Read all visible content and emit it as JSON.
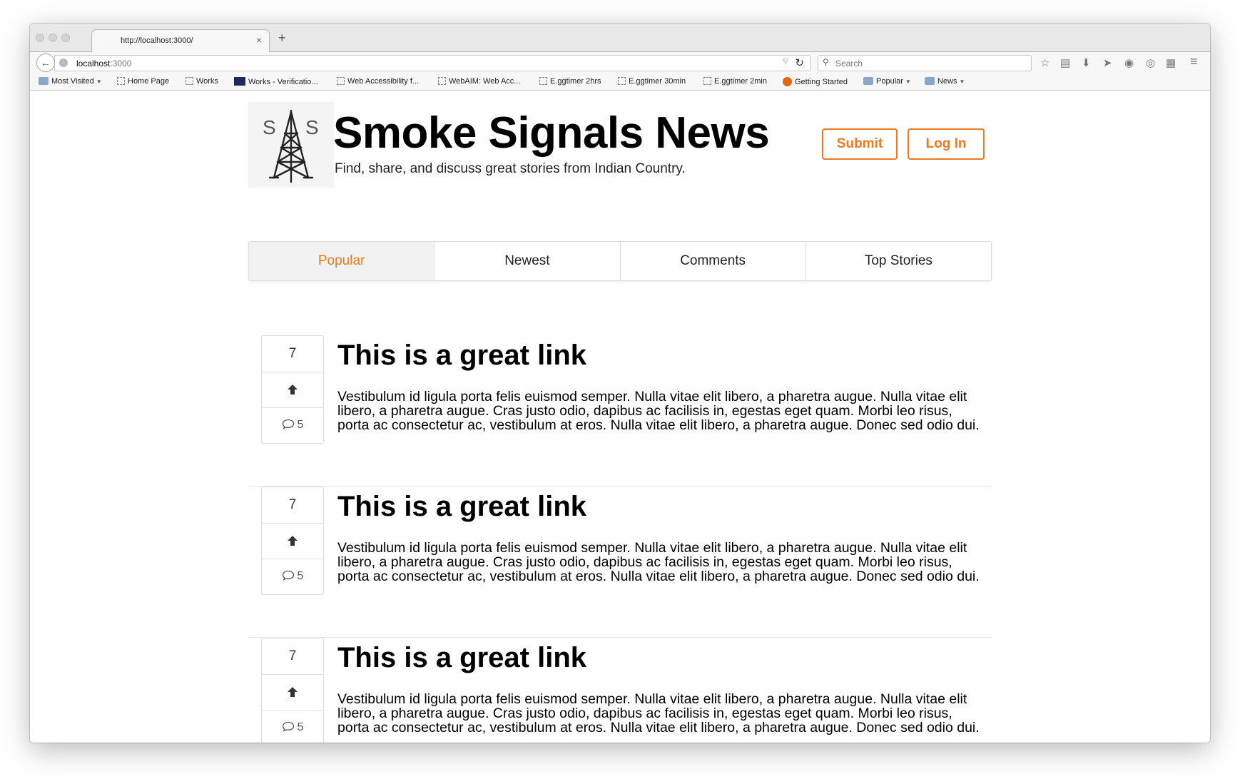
{
  "browser": {
    "tab_title": "http://localhost:3000/",
    "tab_close": "×",
    "new_tab": "+",
    "url_host": "localhost",
    "url_port": ":3000",
    "search_placeholder": "Search",
    "bookmarks": [
      {
        "label": "Most Visited",
        "icon": "folder-icon",
        "menu": true
      },
      {
        "label": "Home Page",
        "icon": "page-icon"
      },
      {
        "label": "Works",
        "icon": "page-icon"
      },
      {
        "label": "Works - Verificatio...",
        "icon": "site-logo-icon"
      },
      {
        "label": "Web Accessibility f...",
        "icon": "page-icon"
      },
      {
        "label": "WebAIM: Web Acc...",
        "icon": "page-icon"
      },
      {
        "label": "E.ggtimer 2hrs",
        "icon": "page-icon"
      },
      {
        "label": "E.ggtimer 30min",
        "icon": "page-icon"
      },
      {
        "label": "E.ggtimer 2min",
        "icon": "page-icon"
      },
      {
        "label": "Getting Started",
        "icon": "firefox-icon"
      },
      {
        "label": "Popular",
        "icon": "folder-icon",
        "menu": true
      },
      {
        "label": "News",
        "icon": "folder-icon",
        "menu": true
      }
    ]
  },
  "site": {
    "logo_letters": [
      "S",
      "S"
    ],
    "title": "Smoke Signals News",
    "tagline": "Find, share, and discuss great stories from Indian Country.",
    "submit_label": "Submit",
    "login_label": "Log In",
    "accent_color": "#f0781e"
  },
  "nav_tabs": [
    {
      "label": "Popular",
      "active": true
    },
    {
      "label": "Newest",
      "active": false
    },
    {
      "label": "Comments",
      "active": false
    },
    {
      "label": "Top Stories",
      "active": false
    }
  ],
  "stories": [
    {
      "votes": "7",
      "comments": "5",
      "title": "This is a great link",
      "body": "Vestibulum id ligula porta felis euismod semper. Nulla vitae elit libero, a pharetra augue. Nulla vitae elit libero, a pharetra augue. Cras justo odio, dapibus ac facilisis in, egestas eget quam. Morbi leo risus, porta ac consectetur ac, vestibulum at eros. Nulla vitae elit libero, a pharetra augue. Donec sed odio dui."
    },
    {
      "votes": "7",
      "comments": "5",
      "title": "This is a great link",
      "body": "Vestibulum id ligula porta felis euismod semper. Nulla vitae elit libero, a pharetra augue. Nulla vitae elit libero, a pharetra augue. Cras justo odio, dapibus ac facilisis in, egestas eget quam. Morbi leo risus, porta ac consectetur ac, vestibulum at eros. Nulla vitae elit libero, a pharetra augue. Donec sed odio dui."
    },
    {
      "votes": "7",
      "comments": "5",
      "title": "This is a great link",
      "body": "Vestibulum id ligula porta felis euismod semper. Nulla vitae elit libero, a pharetra augue. Nulla vitae elit libero, a pharetra augue. Cras justo odio, dapibus ac facilisis in, egestas eget quam. Morbi leo risus, porta ac consectetur ac, vestibulum at eros. Nulla vitae elit libero, a pharetra augue. Donec sed odio dui."
    }
  ]
}
